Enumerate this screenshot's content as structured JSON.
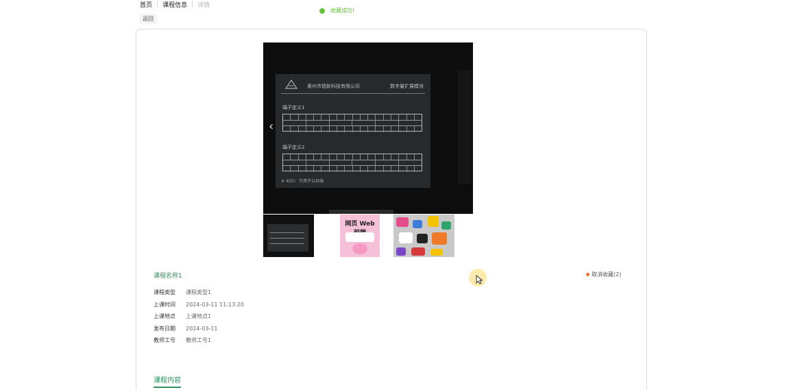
{
  "breadcrumb": {
    "home": "首页",
    "course_info": "课程信息",
    "current": "详情"
  },
  "toast": {
    "message": "收藏成功!",
    "color": "#67c23a"
  },
  "back_label": "返回",
  "gallery": {
    "main_image": {
      "company": "黄州市德新科技有限公司",
      "module": "数字量扩展模块",
      "section1": "端子定义1",
      "section2": "端子定义2",
      "note": "※ 4DO：只用于公共端"
    },
    "thumbnails": [
      {
        "label": ""
      },
      {
        "label": "网页 Web前端"
      },
      {
        "label": ""
      }
    ]
  },
  "course": {
    "name": "课程名称1",
    "favorite_label": "取消收藏(2)",
    "fields": [
      {
        "key": "课程类型",
        "value": "课程类型1"
      },
      {
        "key": "上课时间",
        "value": "2024-03-11 11:13:20"
      },
      {
        "key": "上课地点",
        "value": "上课地点1"
      },
      {
        "key": "发布日期",
        "value": "2024-03-11"
      },
      {
        "key": "教师工号",
        "value": "教师工号1"
      }
    ]
  },
  "tabs": [
    {
      "label": "课程内容"
    }
  ],
  "colors": {
    "accent": "#2f8f60",
    "favorite_dot": "#f56c2d"
  }
}
